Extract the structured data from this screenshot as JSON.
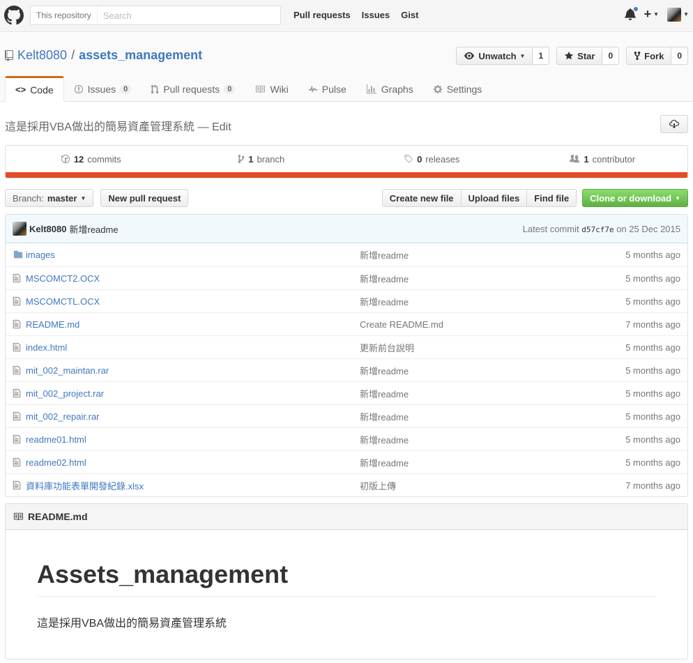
{
  "header": {
    "search_scope": "This repository",
    "search_placeholder": "Search",
    "nav": [
      "Pull requests",
      "Issues",
      "Gist"
    ]
  },
  "repo": {
    "owner": "Kelt8080",
    "separator": "/",
    "name": "assets_management",
    "watch_label": "Unwatch",
    "watch_count": "1",
    "star_label": "Star",
    "star_count": "0",
    "fork_label": "Fork",
    "fork_count": "0"
  },
  "tabs": [
    {
      "label": "Code",
      "icon": "code-icon",
      "selected": true
    },
    {
      "label": "Issues",
      "icon": "issue-icon",
      "counter": "0"
    },
    {
      "label": "Pull requests",
      "icon": "pr-icon",
      "counter": "0"
    },
    {
      "label": "Wiki",
      "icon": "book-icon"
    },
    {
      "label": "Pulse",
      "icon": "pulse-icon"
    },
    {
      "label": "Graphs",
      "icon": "graph-icon"
    },
    {
      "label": "Settings",
      "icon": "gear-icon"
    }
  ],
  "description": {
    "text": "這是採用VBA做出的簡易資產管理系統",
    "dash": "—",
    "edit": "Edit"
  },
  "summary": {
    "commits_count": "12",
    "commits_label": "commits",
    "branch_count": "1",
    "branch_label": "branch",
    "releases_count": "0",
    "releases_label": "releases",
    "contributor_count": "1",
    "contributor_label": "contributor",
    "language_color": "#e34c26"
  },
  "file_nav": {
    "branch_prefix": "Branch:",
    "branch_name": "master",
    "new_pr": "New pull request",
    "create_file": "Create new file",
    "upload_files": "Upload files",
    "find_file": "Find file",
    "clone": "Clone or download"
  },
  "commit": {
    "author": "Kelt8080",
    "message": "新增readme",
    "latest_label": "Latest commit",
    "sha": "d57cf7e",
    "date": "on 25 Dec 2015"
  },
  "files": [
    {
      "name": "images",
      "type": "dir",
      "message": "新增readme",
      "age": "5 months ago"
    },
    {
      "name": "MSCOMCT2.OCX",
      "type": "file",
      "message": "新增readme",
      "age": "5 months ago"
    },
    {
      "name": "MSCOMCTL.OCX",
      "type": "file",
      "message": "新增readme",
      "age": "5 months ago"
    },
    {
      "name": "README.md",
      "type": "file",
      "message": "Create README.md",
      "age": "7 months ago"
    },
    {
      "name": "index.html",
      "type": "file",
      "message": "更新前台說明",
      "age": "5 months ago"
    },
    {
      "name": "mit_002_maintan.rar",
      "type": "file",
      "message": "新增readme",
      "age": "5 months ago"
    },
    {
      "name": "mit_002_project.rar",
      "type": "file",
      "message": "新增readme",
      "age": "5 months ago"
    },
    {
      "name": "mit_002_repair.rar",
      "type": "file",
      "message": "新增readme",
      "age": "5 months ago"
    },
    {
      "name": "readme01.html",
      "type": "file",
      "message": "新增readme",
      "age": "5 months ago"
    },
    {
      "name": "readme02.html",
      "type": "file",
      "message": "新增readme",
      "age": "5 months ago"
    },
    {
      "name": "資料庫功能表單開發紀錄.xlsx",
      "type": "file",
      "message": "初版上傳",
      "age": "7 months ago"
    }
  ],
  "readme": {
    "filename": "README.md",
    "heading": "Assets_management",
    "body": "這是採用VBA做出的簡易資產管理系統"
  }
}
